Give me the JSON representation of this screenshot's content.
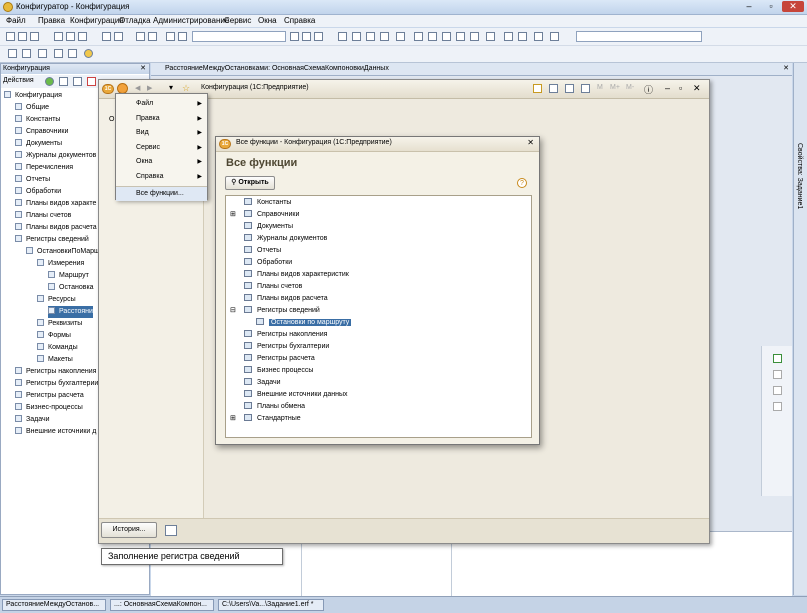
{
  "app": {
    "title": "Конфигуратор - Конфигурация"
  },
  "menubar": [
    "Файл",
    "Правка",
    "Конфигурация",
    "Отладка",
    "Администрирование",
    "Сервис",
    "Окна",
    "Справка"
  ],
  "config_panel": {
    "title": "Конфигурация",
    "actions_label": "Действия",
    "tree": [
      {
        "label": "Конфигурация",
        "level": 0
      },
      {
        "label": "Общие",
        "level": 1
      },
      {
        "label": "Константы",
        "level": 1
      },
      {
        "label": "Справочники",
        "level": 1
      },
      {
        "label": "Документы",
        "level": 1
      },
      {
        "label": "Журналы документов",
        "level": 1
      },
      {
        "label": "Перечисления",
        "level": 1
      },
      {
        "label": "Отчеты",
        "level": 1
      },
      {
        "label": "Обработки",
        "level": 1
      },
      {
        "label": "Планы видов характе",
        "level": 1
      },
      {
        "label": "Планы счетов",
        "level": 1
      },
      {
        "label": "Планы видов расчета",
        "level": 1
      },
      {
        "label": "Регистры сведений",
        "level": 1
      },
      {
        "label": "ОстановкиПоМарш",
        "level": 2
      },
      {
        "label": "Измерения",
        "level": 3
      },
      {
        "label": "Маршрут",
        "level": 4
      },
      {
        "label": "Остановка",
        "level": 4
      },
      {
        "label": "Ресурсы",
        "level": 3
      },
      {
        "label": "Расстояни",
        "level": 4,
        "selected": true
      },
      {
        "label": "Реквизиты",
        "level": 3
      },
      {
        "label": "Формы",
        "level": 3
      },
      {
        "label": "Команды",
        "level": 3
      },
      {
        "label": "Макеты",
        "level": 3
      },
      {
        "label": "Регистры накопления",
        "level": 1
      },
      {
        "label": "Регистры бухгалтерии",
        "level": 1
      },
      {
        "label": "Регистры расчета",
        "level": 1
      },
      {
        "label": "Бизнес-процессы",
        "level": 1
      },
      {
        "label": "Задачи",
        "level": 1
      },
      {
        "label": "Внешние источники д",
        "level": 1
      }
    ]
  },
  "doc_tab": {
    "title": "РасстояниеМеждуОстановками: ОсновнаяСхемаКомпоновкиДанных"
  },
  "right_panel": {
    "label": "Свойства: Задание1"
  },
  "client_window": {
    "title": "Конфигурация  (1С:Предприятие)",
    "history_button": "История...",
    "menu": [
      {
        "label": "Файл",
        "submenu": true
      },
      {
        "label": "Правка",
        "submenu": true
      },
      {
        "label": "Вид",
        "submenu": true
      },
      {
        "label": "Сервис",
        "submenu": true
      },
      {
        "label": "Окна",
        "submenu": true
      },
      {
        "label": "Справка",
        "submenu": true
      },
      {
        "label": "Все функции...",
        "submenu": false
      }
    ]
  },
  "all_functions": {
    "window_title": "Все функции - Конфигурация  (1С:Предприятие)",
    "heading": "Все функции",
    "open_button": "Открыть",
    "help": "?",
    "items": [
      {
        "label": "Константы",
        "level": 0
      },
      {
        "label": "Справочники",
        "level": 0,
        "expander": "+"
      },
      {
        "label": "Документы",
        "level": 0
      },
      {
        "label": "Журналы документов",
        "level": 0
      },
      {
        "label": "Отчеты",
        "level": 0
      },
      {
        "label": "Обработки",
        "level": 0
      },
      {
        "label": "Планы видов характеристик",
        "level": 0
      },
      {
        "label": "Планы счетов",
        "level": 0
      },
      {
        "label": "Планы видов расчета",
        "level": 0
      },
      {
        "label": "Регистры сведений",
        "level": 0,
        "expander": "−"
      },
      {
        "label": "Остановки по маршруту",
        "level": 1,
        "selected": true
      },
      {
        "label": "Регистры накопления",
        "level": 0
      },
      {
        "label": "Регистры бухгалтерии",
        "level": 0
      },
      {
        "label": "Регистры расчета",
        "level": 0
      },
      {
        "label": "Бизнес процессы",
        "level": 0
      },
      {
        "label": "Задачи",
        "level": 0
      },
      {
        "label": "Внешние источники данных",
        "level": 0
      },
      {
        "label": "Планы обмена",
        "level": 0
      },
      {
        "label": "Стандартные",
        "level": 0,
        "expander": "+"
      }
    ]
  },
  "tooltip": {
    "text": "Заполнение регистра сведений"
  },
  "taskbar": [
    {
      "label": "РасстояниеМеждуОстанов..."
    },
    {
      "label": "...: ОсновнаяСхемаКомпон..."
    },
    {
      "label": "C:\\Users\\Va...\\Задание1.erf *"
    }
  ]
}
